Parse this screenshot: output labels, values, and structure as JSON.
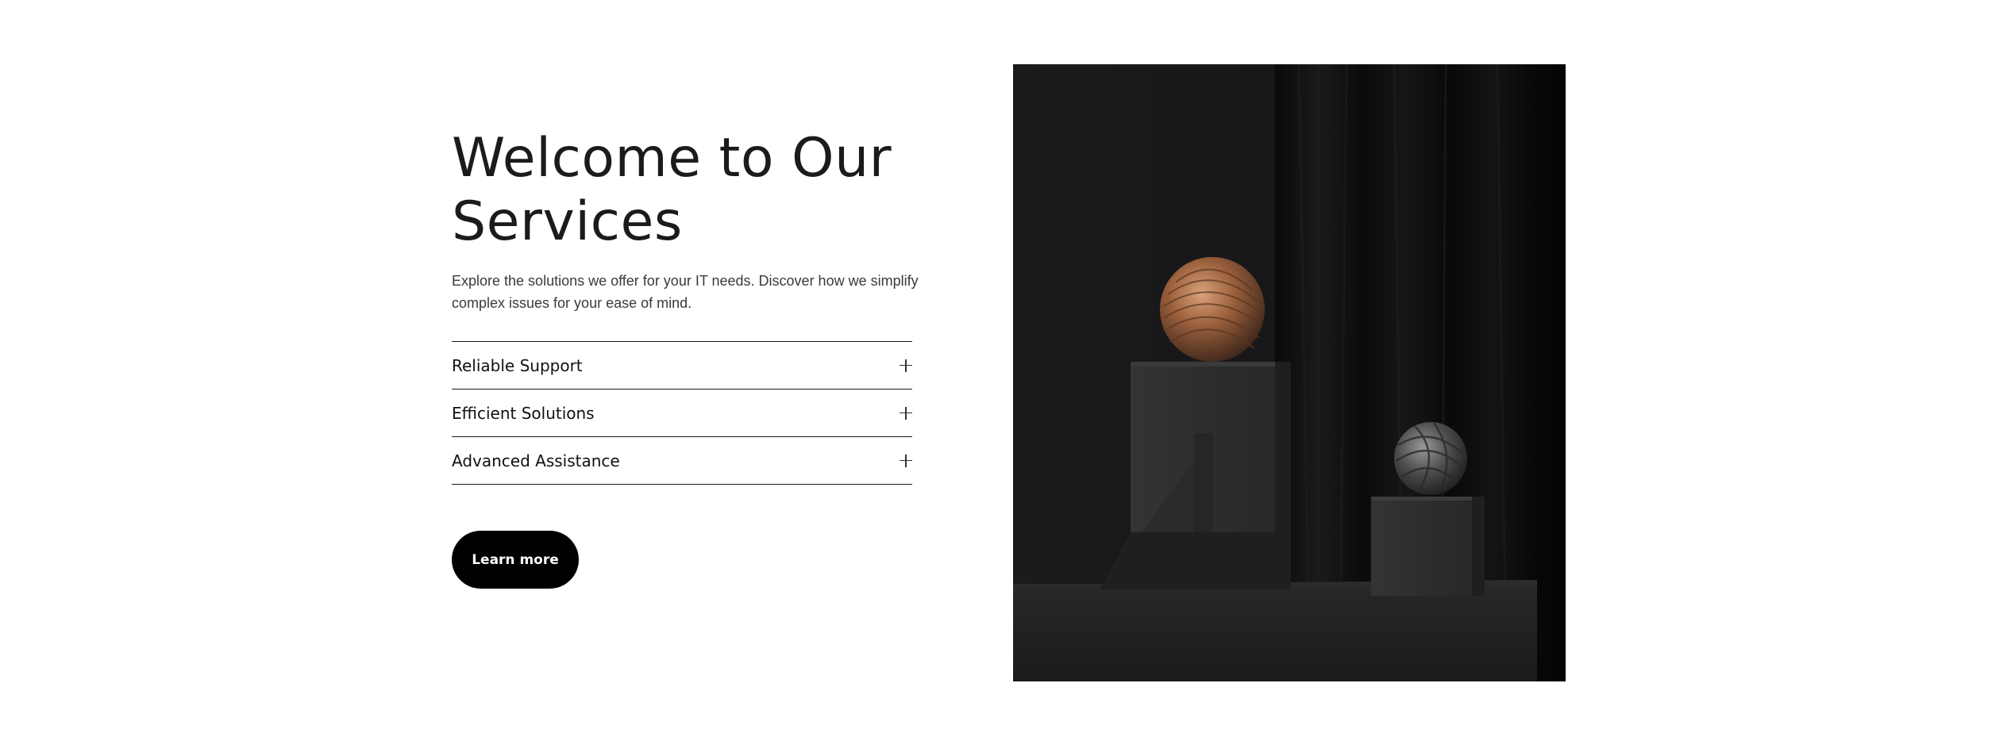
{
  "hero": {
    "title_line1": "Welcome to Our",
    "title_line2": "Services",
    "description": "Explore the solutions we offer for your IT needs. Discover how we simplify complex issues for your ease of mind."
  },
  "accordion": {
    "items": [
      {
        "label": "Reliable Support",
        "icon": "plus-icon"
      },
      {
        "label": "Efficient Solutions",
        "icon": "plus-icon"
      },
      {
        "label": "Advanced Assistance",
        "icon": "plus-icon"
      }
    ]
  },
  "cta": {
    "label": "Learn more"
  },
  "colors": {
    "accent": "#000000",
    "text": "#1b1b1b",
    "image_background": "#0d0d0e"
  }
}
